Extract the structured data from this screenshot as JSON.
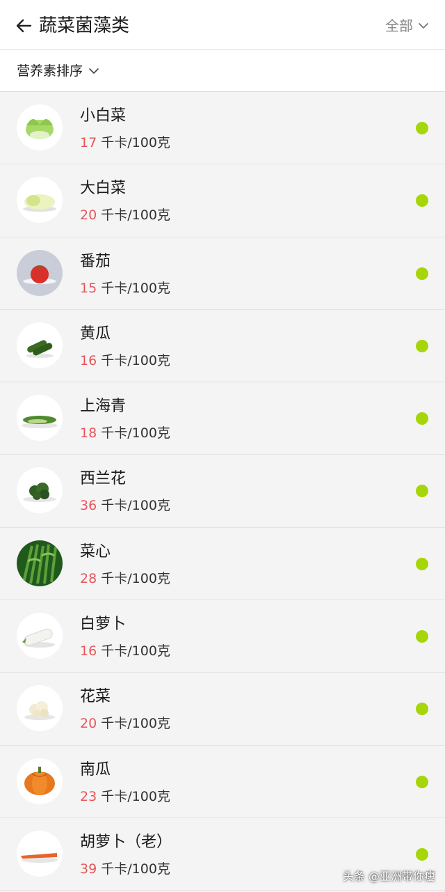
{
  "header": {
    "title": "蔬菜菌藻类",
    "filter_label": "全部"
  },
  "sortbar": {
    "sort_label": "营养素排序"
  },
  "colors": {
    "accent_dot": "#a6d60a",
    "calorie_number": "#e8555a"
  },
  "unit": "千卡/100克",
  "items": [
    {
      "name": "小白菜",
      "kcal": "17",
      "icon": "bok-choy-icon"
    },
    {
      "name": "大白菜",
      "kcal": "20",
      "icon": "napa-cabbage-icon"
    },
    {
      "name": "番茄",
      "kcal": "15",
      "icon": "tomato-icon"
    },
    {
      "name": "黄瓜",
      "kcal": "16",
      "icon": "cucumber-icon"
    },
    {
      "name": "上海青",
      "kcal": "18",
      "icon": "shanghai-greens-icon"
    },
    {
      "name": "西兰花",
      "kcal": "36",
      "icon": "broccoli-icon"
    },
    {
      "name": "菜心",
      "kcal": "28",
      "icon": "choy-sum-icon"
    },
    {
      "name": "白萝卜",
      "kcal": "16",
      "icon": "daikon-icon"
    },
    {
      "name": "花菜",
      "kcal": "20",
      "icon": "cauliflower-icon"
    },
    {
      "name": "南瓜",
      "kcal": "23",
      "icon": "pumpkin-icon"
    },
    {
      "name": "胡萝卜（老）",
      "kcal": "39",
      "icon": "carrot-icon"
    }
  ],
  "watermark": "头条 @亚洲带你瘦"
}
